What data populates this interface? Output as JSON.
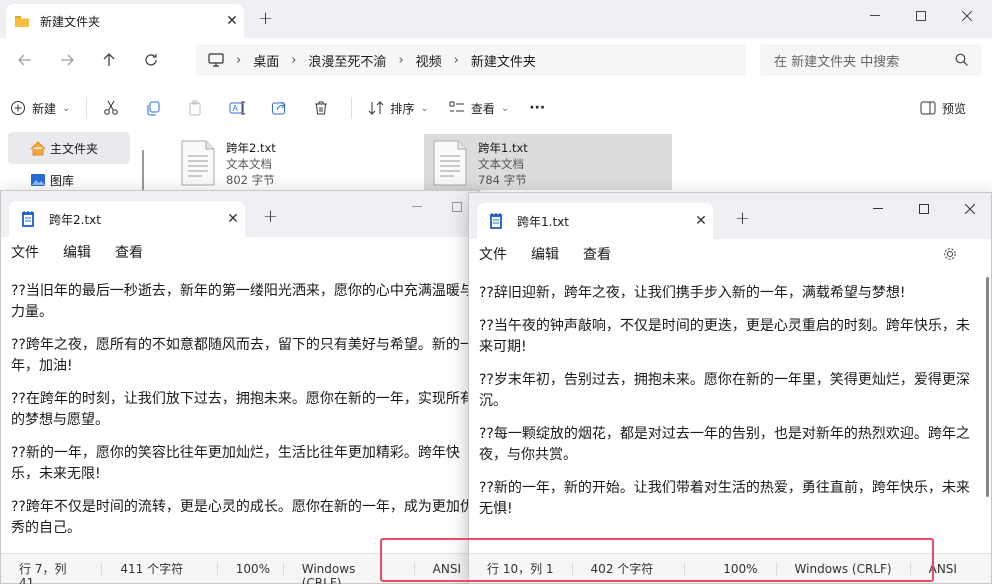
{
  "explorer": {
    "tab_title": "新建文件夹",
    "breadcrumbs": [
      "桌面",
      "浪漫至死不渝",
      "视频",
      "新建文件夹"
    ],
    "search_placeholder": "在 新建文件夹 中搜索",
    "toolbar": {
      "new": "新建",
      "sort": "排序",
      "view": "查看",
      "more": "···",
      "preview": "预览"
    },
    "sidebar": [
      {
        "label": "主文件夹"
      },
      {
        "label": "图库"
      }
    ],
    "files": [
      {
        "name": "跨年2.txt",
        "type": "文本文档",
        "size": "802 字节"
      },
      {
        "name": "跨年1.txt",
        "type": "文本文档",
        "size": "784 字节"
      }
    ]
  },
  "notepad2": {
    "tab_title": "跨年2.txt",
    "menu": [
      "文件",
      "编辑",
      "查看"
    ],
    "lines": [
      "??当旧年的最后一秒逝去，新年的第一缕阳光洒来，愿你的心中充满温暖与力量。",
      "??跨年之夜，愿所有的不如意都随风而去，留下的只有美好与希望。新的一年，加油!",
      "??在跨年的时刻，让我们放下过去，拥抱未来。愿你在新的一年，实现所有的梦想与愿望。",
      "??新的一年，愿你的笑容比往年更加灿烂，生活比往年更加精彩。跨年快乐，未来无限!",
      "??跨年不仅是时间的流转，更是心灵的成长。愿你在新的一年，成为更加优秀的自己。"
    ],
    "status": {
      "position": "行 7，列 41",
      "chars": "411 个字符",
      "zoom": "100%",
      "eol": "Windows (CRLF)",
      "encoding": "ANSI"
    }
  },
  "notepad1": {
    "tab_title": "跨年1.txt",
    "menu": [
      "文件",
      "编辑",
      "查看"
    ],
    "lines": [
      "??辞旧迎新，跨年之夜，让我们携手步入新的一年，满载希望与梦想!",
      "??当午夜的钟声敲响，不仅是时间的更迭，更是心灵重启的时刻。跨年快乐，未来可期!",
      "??岁末年初，告别过去，拥抱未来。愿你在新的一年里，笑得更灿烂，爱得更深沉。",
      "??每一颗绽放的烟花，都是对过去一年的告别，也是对新年的热烈欢迎。跨年之夜，与你共赏。",
      "??新的一年，新的开始。让我们带着对生活的热爱，勇往直前，跨年快乐，未来无惧!"
    ],
    "status": {
      "position": "行 10，列 1",
      "chars": "402 个字符",
      "zoom": "100%",
      "eol": "Windows (CRLF)",
      "encoding": "ANSI"
    }
  },
  "colors": {
    "highlight": "#ea4b6a",
    "folder": "#f4c042",
    "notepad_icon": "#2b6cd6"
  }
}
